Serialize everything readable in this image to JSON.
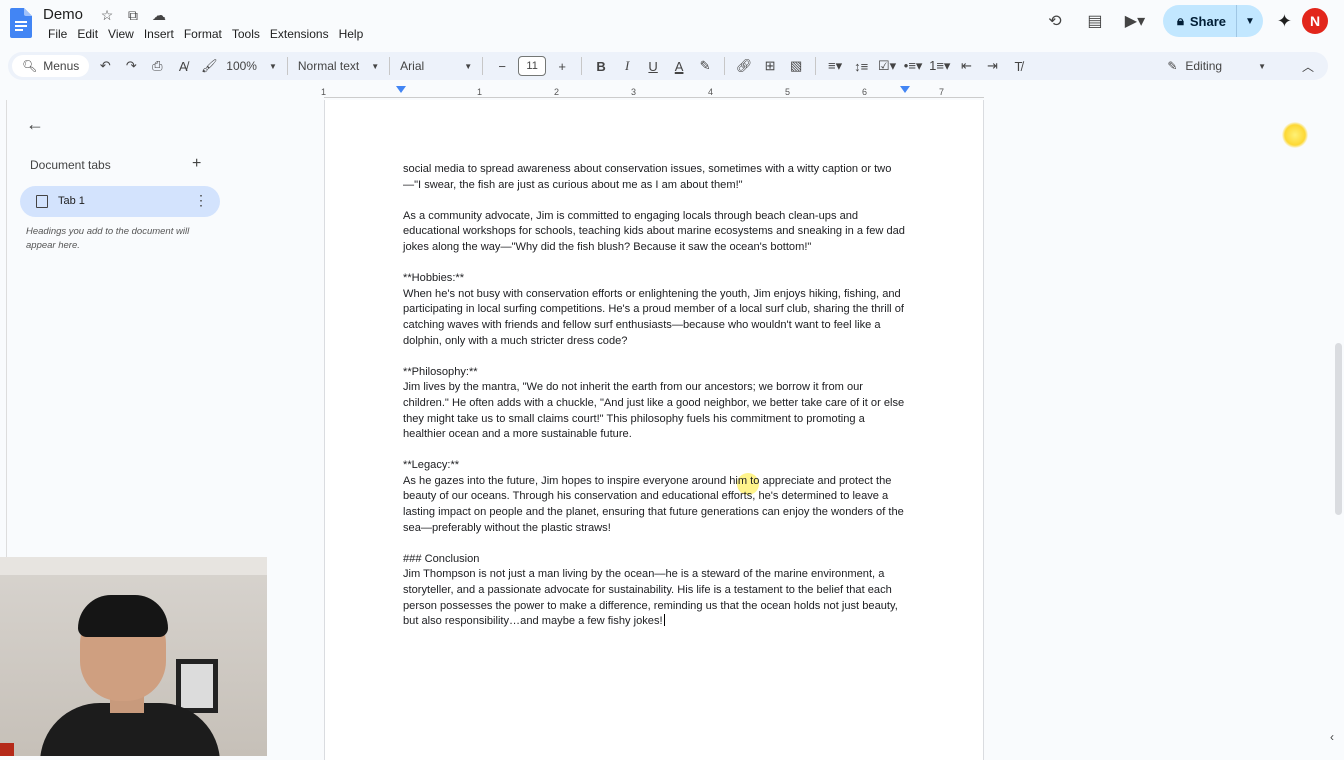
{
  "app": {
    "doc_title": "Demo",
    "avatar_letter": "N",
    "accent": "#1a73e8",
    "share_bg": "#c2e7ff",
    "avatar_bg": "#e2261b"
  },
  "menus": [
    "File",
    "Edit",
    "View",
    "Insert",
    "Format",
    "Tools",
    "Extensions",
    "Help"
  ],
  "header": {
    "share_label": "Share"
  },
  "toolbar": {
    "search_label": "Menus",
    "zoom": "100%",
    "style": "Normal text",
    "font": "Arial",
    "font_size": "11",
    "mode": "Editing"
  },
  "ruler": {
    "numbers": [
      "1",
      "1",
      "2",
      "3",
      "4",
      "5",
      "6",
      "7"
    ]
  },
  "sidebar": {
    "heading": "Document tabs",
    "tab_label": "Tab 1",
    "hint": "Headings you add to the document will appear here."
  },
  "document": {
    "p1": "social media to spread awareness about conservation issues, sometimes with a witty caption or two—\"I swear, the fish are just as curious about me as I am about them!\"",
    "p2": "As a community advocate, Jim is committed to engaging locals through beach clean-ups and educational workshops for schools, teaching kids about marine ecosystems and sneaking in a few dad jokes along the way—\"Why did the fish blush? Because it saw the ocean's bottom!\"",
    "h_hobbies": "**Hobbies:**",
    "p3": "When he's not busy with conservation efforts or enlightening the youth, Jim enjoys hiking, fishing, and participating in local surfing competitions. He's a proud member of a local surf club, sharing the thrill of catching waves with friends and fellow surf enthusiasts—because who wouldn't want to feel like a dolphin, only with a much stricter dress code?",
    "h_philosophy": "**Philosophy:**",
    "p4": "Jim lives by the mantra, \"We do not inherit the earth from our ancestors; we borrow it from our children.\" He often adds with a chuckle, \"And just like a good neighbor, we better take care of it or else they might take us to small claims court!\" This philosophy fuels his commitment to promoting a healthier ocean and a more sustainable future.",
    "h_legacy": "**Legacy:**",
    "p5": "As he gazes into the future, Jim hopes to inspire everyone around him to appreciate and protect the beauty of our oceans. Through his conservation and educational efforts, he's determined to leave a lasting impact on people and the planet, ensuring that future generations can enjoy the wonders of the sea—preferably without the plastic straws!",
    "h_conclusion": "### Conclusion",
    "p6": "Jim Thompson is not just a man living by the ocean—he is a steward of the marine environment, a storyteller, and a passionate advocate for sustainability. His life is a testament to the belief that each person possesses the power to make a difference, reminding us that the ocean holds not just beauty, but also responsibility…and maybe a few fishy jokes!"
  }
}
